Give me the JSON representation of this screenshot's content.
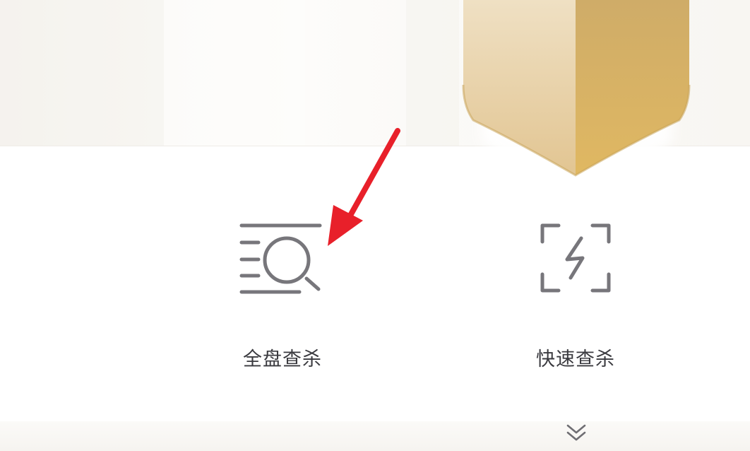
{
  "actions": {
    "full_scan": {
      "label": "全盘查杀",
      "icon": "full-scan-search-icon"
    },
    "quick_scan": {
      "label": "快速查杀",
      "icon": "quick-scan-lightning-icon"
    }
  },
  "expand": {
    "icon": "double-chevron-down-icon"
  },
  "annotation": {
    "icon": "red-arrow-icon",
    "color": "#e8202a"
  },
  "colors": {
    "shield_light": "#ecd6ae",
    "shield_dark": "#d6b06a",
    "icon_gray": "#77767b",
    "label_text": "#3a3a3f"
  }
}
